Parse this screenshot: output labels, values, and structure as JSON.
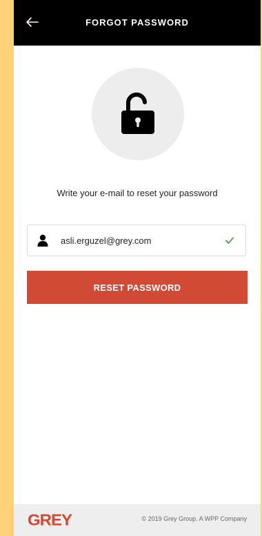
{
  "header": {
    "title": "FORGOT PASSWORD",
    "back_icon": "arrow-left-icon"
  },
  "hero": {
    "icon": "unlocked-padlock-icon"
  },
  "instruction": "Write your e-mail to reset your password",
  "email_field": {
    "value": "asli.erguzel@grey.com",
    "leading_icon": "user-icon",
    "trailing_icon": "check-icon",
    "valid_color": "#5aa55a"
  },
  "reset_button": {
    "label": "RESET PASSWORD",
    "color": "#d14a36"
  },
  "footer": {
    "logo": "GREY",
    "copyright": "© 2019 Grey Group. A WPP Company"
  },
  "colors": {
    "frame_background": "#ffd279",
    "header_background": "#000000",
    "accent": "#d14a36"
  }
}
